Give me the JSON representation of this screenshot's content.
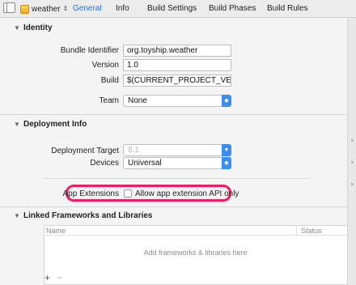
{
  "topbar": {
    "target_name": "weather",
    "tabs": [
      "General",
      "Info",
      "Build Settings",
      "Build Phases",
      "Build Rules"
    ]
  },
  "identity": {
    "title": "Identity",
    "bundle_identifier_label": "Bundle Identifier",
    "bundle_identifier_value": "org.toyship.weather",
    "version_label": "Version",
    "version_value": "1.0",
    "build_label": "Build",
    "build_value": "$(CURRENT_PROJECT_VERSION)",
    "team_label": "Team",
    "team_value": "None"
  },
  "deployment": {
    "title": "Deployment Info",
    "target_label": "Deployment Target",
    "target_value": "8.1",
    "devices_label": "Devices",
    "devices_value": "Universal",
    "app_extensions_label": "App Extensions",
    "allow_api_label": "Allow app extension API only"
  },
  "linked": {
    "title": "Linked Frameworks and Libraries",
    "col_name": "Name",
    "col_status": "Status",
    "placeholder": "Add frameworks & libraries here",
    "add": "+",
    "remove": "−"
  },
  "colors": {
    "accent": "#2a72d8",
    "popup_blue": "#3b8ef0",
    "highlight": "#e91e63"
  }
}
